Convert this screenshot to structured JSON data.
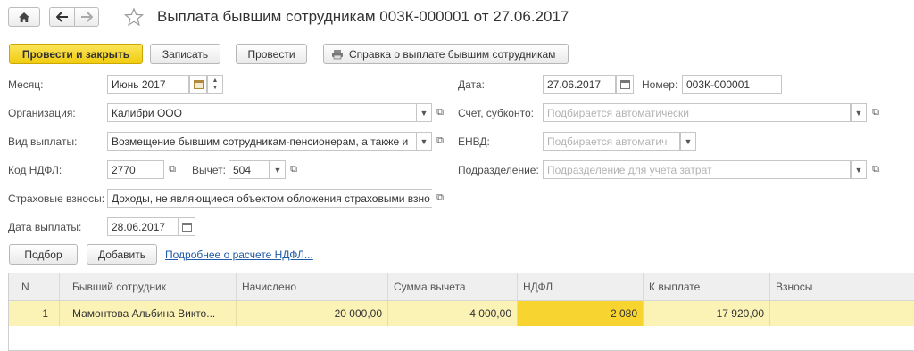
{
  "window": {
    "title": "Выплата бывшим сотрудникам 003К-000001 от 27.06.2017"
  },
  "toolbar": {
    "post_close": "Провести и закрыть",
    "save": "Записать",
    "post": "Провести",
    "report": "Справка о выплате бывшим сотрудникам"
  },
  "form": {
    "month_label": "Месяц:",
    "month_value": "Июнь 2017",
    "org_label": "Организация:",
    "org_value": "Калибри ООО",
    "paytype_label": "Вид выплаты:",
    "paytype_value": "Возмещение бывшим сотрудникам-пенсионерам, а также и",
    "ndfl_label": "Код НДФЛ:",
    "ndfl_value": "2770",
    "deduction_label": "Вычет:",
    "deduction_value": "504",
    "insurance_label": "Страховые взносы:",
    "insurance_value": "Доходы, не являющиеся объектом обложения страховыми взно",
    "paydate_label": "Дата выплаты:",
    "paydate_value": "28.06.2017",
    "date_label": "Дата:",
    "date_value": "27.06.2017",
    "number_label": "Номер:",
    "number_value": "003К-000001",
    "account_label": "Счет, субконто:",
    "account_placeholder": "Подбирается автоматически",
    "envd_label": "ЕНВД:",
    "envd_placeholder": "Подбирается автоматич",
    "division_label": "Подразделение:",
    "division_placeholder": "Подразделение для учета затрат"
  },
  "table_toolbar": {
    "select": "Подбор",
    "add": "Добавить",
    "details_link": "Подробнее о расчете НДФЛ..."
  },
  "table": {
    "columns": [
      "N",
      "Бывший сотрудник",
      "Начислено",
      "Сумма вычета",
      "НДФЛ",
      "К выплате",
      "Взносы"
    ],
    "rows": [
      [
        "1",
        "Мамонтова Альбина Викто...",
        "20 000,00",
        "4 000,00",
        "2 080",
        "17 920,00",
        ""
      ]
    ]
  },
  "colors": {
    "primary_button": "#f5d52a",
    "selected_row": "#fbf3b6",
    "active_cell": "#f7d42f",
    "link": "#1f5aa6"
  }
}
